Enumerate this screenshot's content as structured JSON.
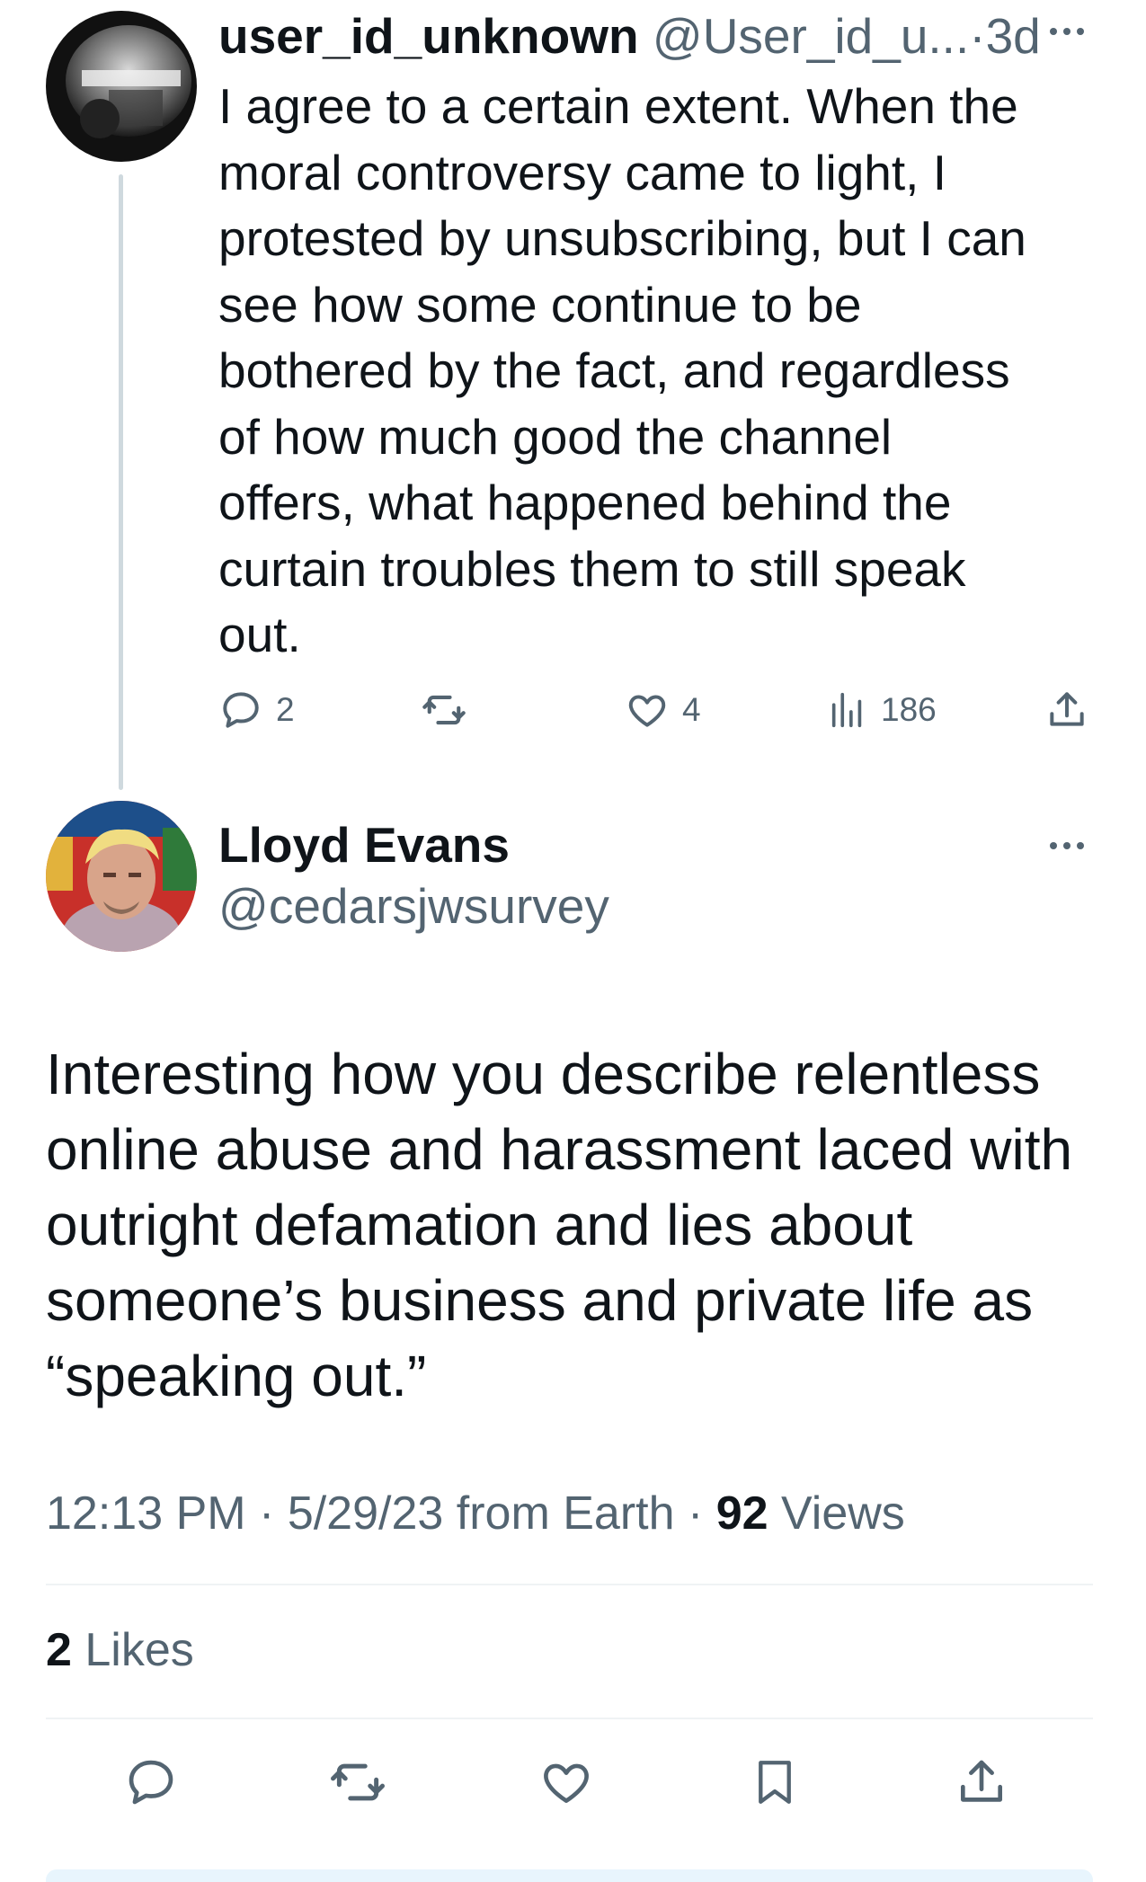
{
  "reply": {
    "display_name": "user_id_unknown",
    "handle": "@User_id_u...",
    "separator": "·",
    "age": "3d",
    "more_icon": "more-horizontal-icon",
    "text": "I agree to a certain extent.  When the\nmoral controversy came to light, I\nprotested by unsubscribing, but I can\nsee how some continue to be\nbothered by the fact, and regardless\nof how much good the channel\noffers, what happened behind the\ncurtain troubles them to still speak\nout.",
    "actions": {
      "replies": "2",
      "reposts": "",
      "likes": "4",
      "views": "186"
    }
  },
  "tweet": {
    "display_name": "Lloyd Evans",
    "handle": "@cedarsjwsurvey",
    "more_icon": "more-horizontal-icon",
    "text": "Interesting how you describe relentless\nonline abuse and harassment laced with\noutright defamation and lies about\nsomeone’s business and private life as\n“speaking out.”",
    "time": "12:13 PM",
    "sep1": "·",
    "date": "5/29/23",
    "source": "from Earth",
    "sep2": "·",
    "views_count": "92",
    "views_label": "Views",
    "likes_count": "2",
    "likes_label": "Likes"
  },
  "colors": {
    "text": "#0f1419",
    "secondary": "#536471",
    "divider": "#eff3f4",
    "thread_line": "#cfd9de"
  }
}
